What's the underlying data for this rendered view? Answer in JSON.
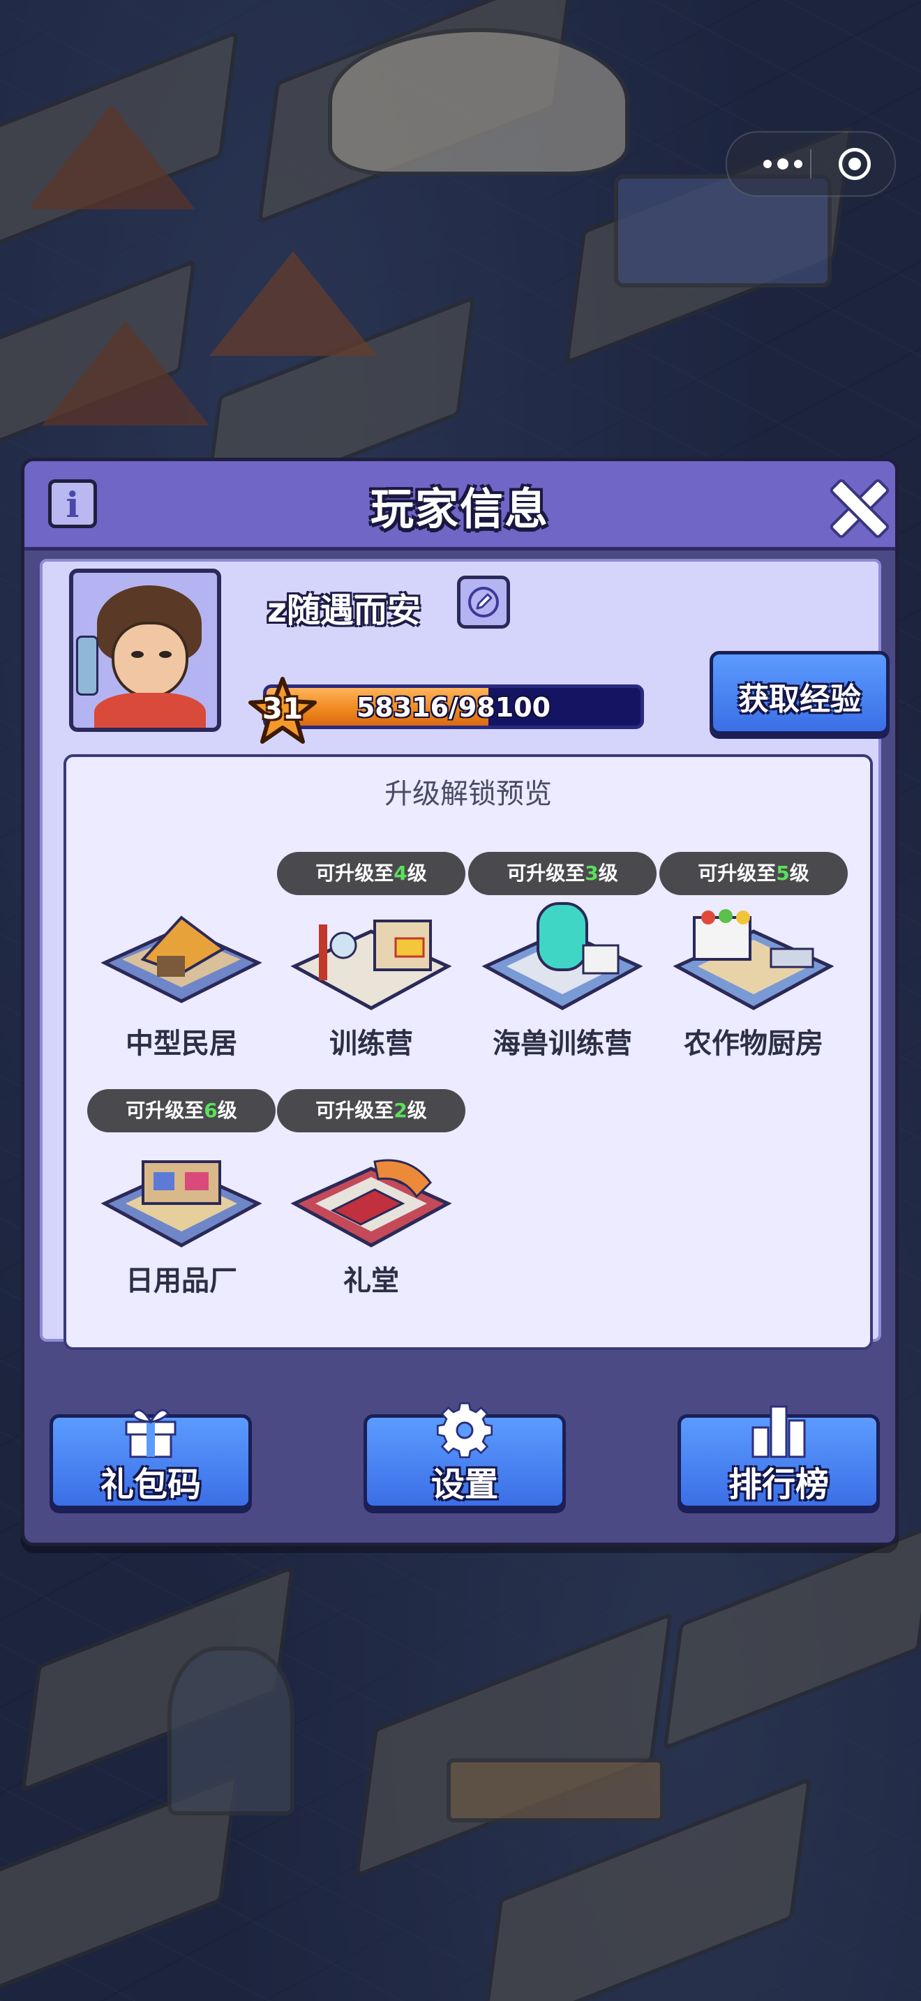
{
  "dialog": {
    "title": "玩家信息",
    "info_icon_glyph": "i"
  },
  "player": {
    "name": "z随遇而安",
    "level": "31",
    "exp_text": "58316/98100",
    "exp_fraction": 0.594,
    "get_exp_label": "获取经验"
  },
  "preview": {
    "title": "升级解锁预览",
    "badge_prefix": "可升级至",
    "badge_suffix": "级",
    "buildings": [
      {
        "name": "中型民居",
        "upgrade_level": null
      },
      {
        "name": "训练营",
        "upgrade_level": "4"
      },
      {
        "name": "海兽训练营",
        "upgrade_level": "3"
      },
      {
        "name": "农作物厨房",
        "upgrade_level": "5"
      },
      {
        "name": "日用品厂",
        "upgrade_level": "6"
      },
      {
        "name": "礼堂",
        "upgrade_level": "2"
      }
    ]
  },
  "actions": {
    "gift_code": "礼包码",
    "settings": "设置",
    "leaderboard": "排行榜"
  },
  "icons": {
    "info": "info-icon",
    "close": "close-icon",
    "edit": "pencil-icon",
    "level": "star-icon",
    "gift": "gift-icon",
    "settings": "gear-icon",
    "leaderboard": "bar-chart-icon",
    "more": "more-dots-icon",
    "capsule_close": "target-icon"
  },
  "colors": {
    "dialog_bg": "#4c4a84",
    "titlebar": "#6f66c6",
    "inner_bg": "#d5d5fb",
    "button_blue": "#3b6fe6",
    "exp_orange": "#f08a20",
    "badge_level_green": "#5be05b"
  }
}
